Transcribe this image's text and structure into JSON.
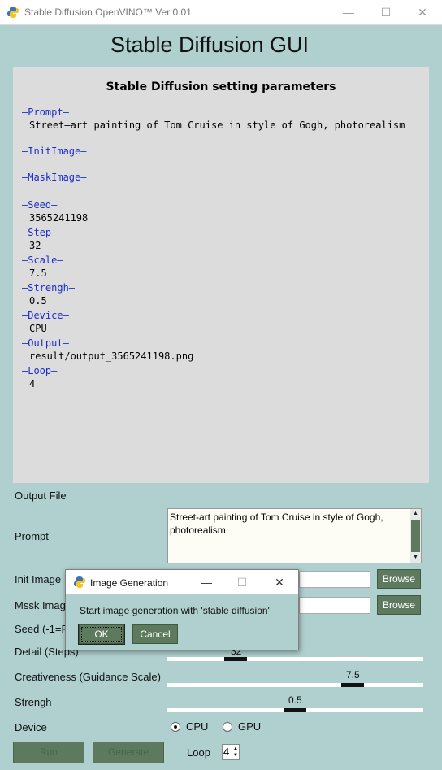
{
  "window": {
    "title": "Stable Diffusion OpenVINO™  Ver 0.01",
    "minimize": "—",
    "maximize": "☐",
    "close": "✕"
  },
  "main_title": "Stable Diffusion GUI",
  "params_panel": {
    "title": "Stable Diffusion setting parameters",
    "prompt_label": "—Prompt—",
    "prompt_value": "Street—art painting of Tom Cruise in style of Gogh, photorealism",
    "initimage_label": "—InitImage—",
    "maskimage_label": "—MaskImage—",
    "seed_label": "—Seed—",
    "seed_value": "3565241198",
    "step_label": "—Step—",
    "step_value": "32",
    "scale_label": "—Scale—",
    "scale_value": "7.5",
    "strengh_label": "—Strengh—",
    "strengh_value": "0.5",
    "device_label": "—Device—",
    "device_value": "CPU",
    "output_label": "—Output—",
    "output_value": "result/output_3565241198.png",
    "loop_label": "—Loop—",
    "loop_value": "4"
  },
  "form": {
    "output_file_label": "Output File",
    "prompt_label": "Prompt",
    "prompt_text": "Street-art painting of Tom Cruise in style of Gogh, photorealism",
    "init_image_label": "Init Image",
    "mask_image_label": "Mssk Imag",
    "browse_label": "Browse",
    "seed_label": "Seed (-1=R",
    "steps_label": "Detail (Steps)",
    "steps_value": "32",
    "scale_label": "Creativeness (Guidance Scale)",
    "scale_value": "7.5",
    "strengh_label": "Strengh",
    "strengh_value": "0.5",
    "device_label": "Device",
    "device_options": [
      "CPU",
      "GPU"
    ],
    "device_selected": "CPU",
    "run_label": "Run",
    "generate_label": "Generate",
    "loop_label": "Loop",
    "loop_value": "4"
  },
  "dialog": {
    "title": "Image Generation",
    "message": "Start image generation with 'stable diffusion'",
    "ok_label": "OK",
    "cancel_label": "Cancel",
    "minimize": "—",
    "maximize": "☐",
    "close": "✕"
  },
  "colors": {
    "background": "#b0cfcf",
    "panel": "#dcdcdc",
    "param_label": "#1d2cc8",
    "button": "#5e7a5e"
  },
  "slider_levels": {
    "steps_fraction": 0.27,
    "scale_fraction": 0.73,
    "strengh_fraction": 0.5
  }
}
